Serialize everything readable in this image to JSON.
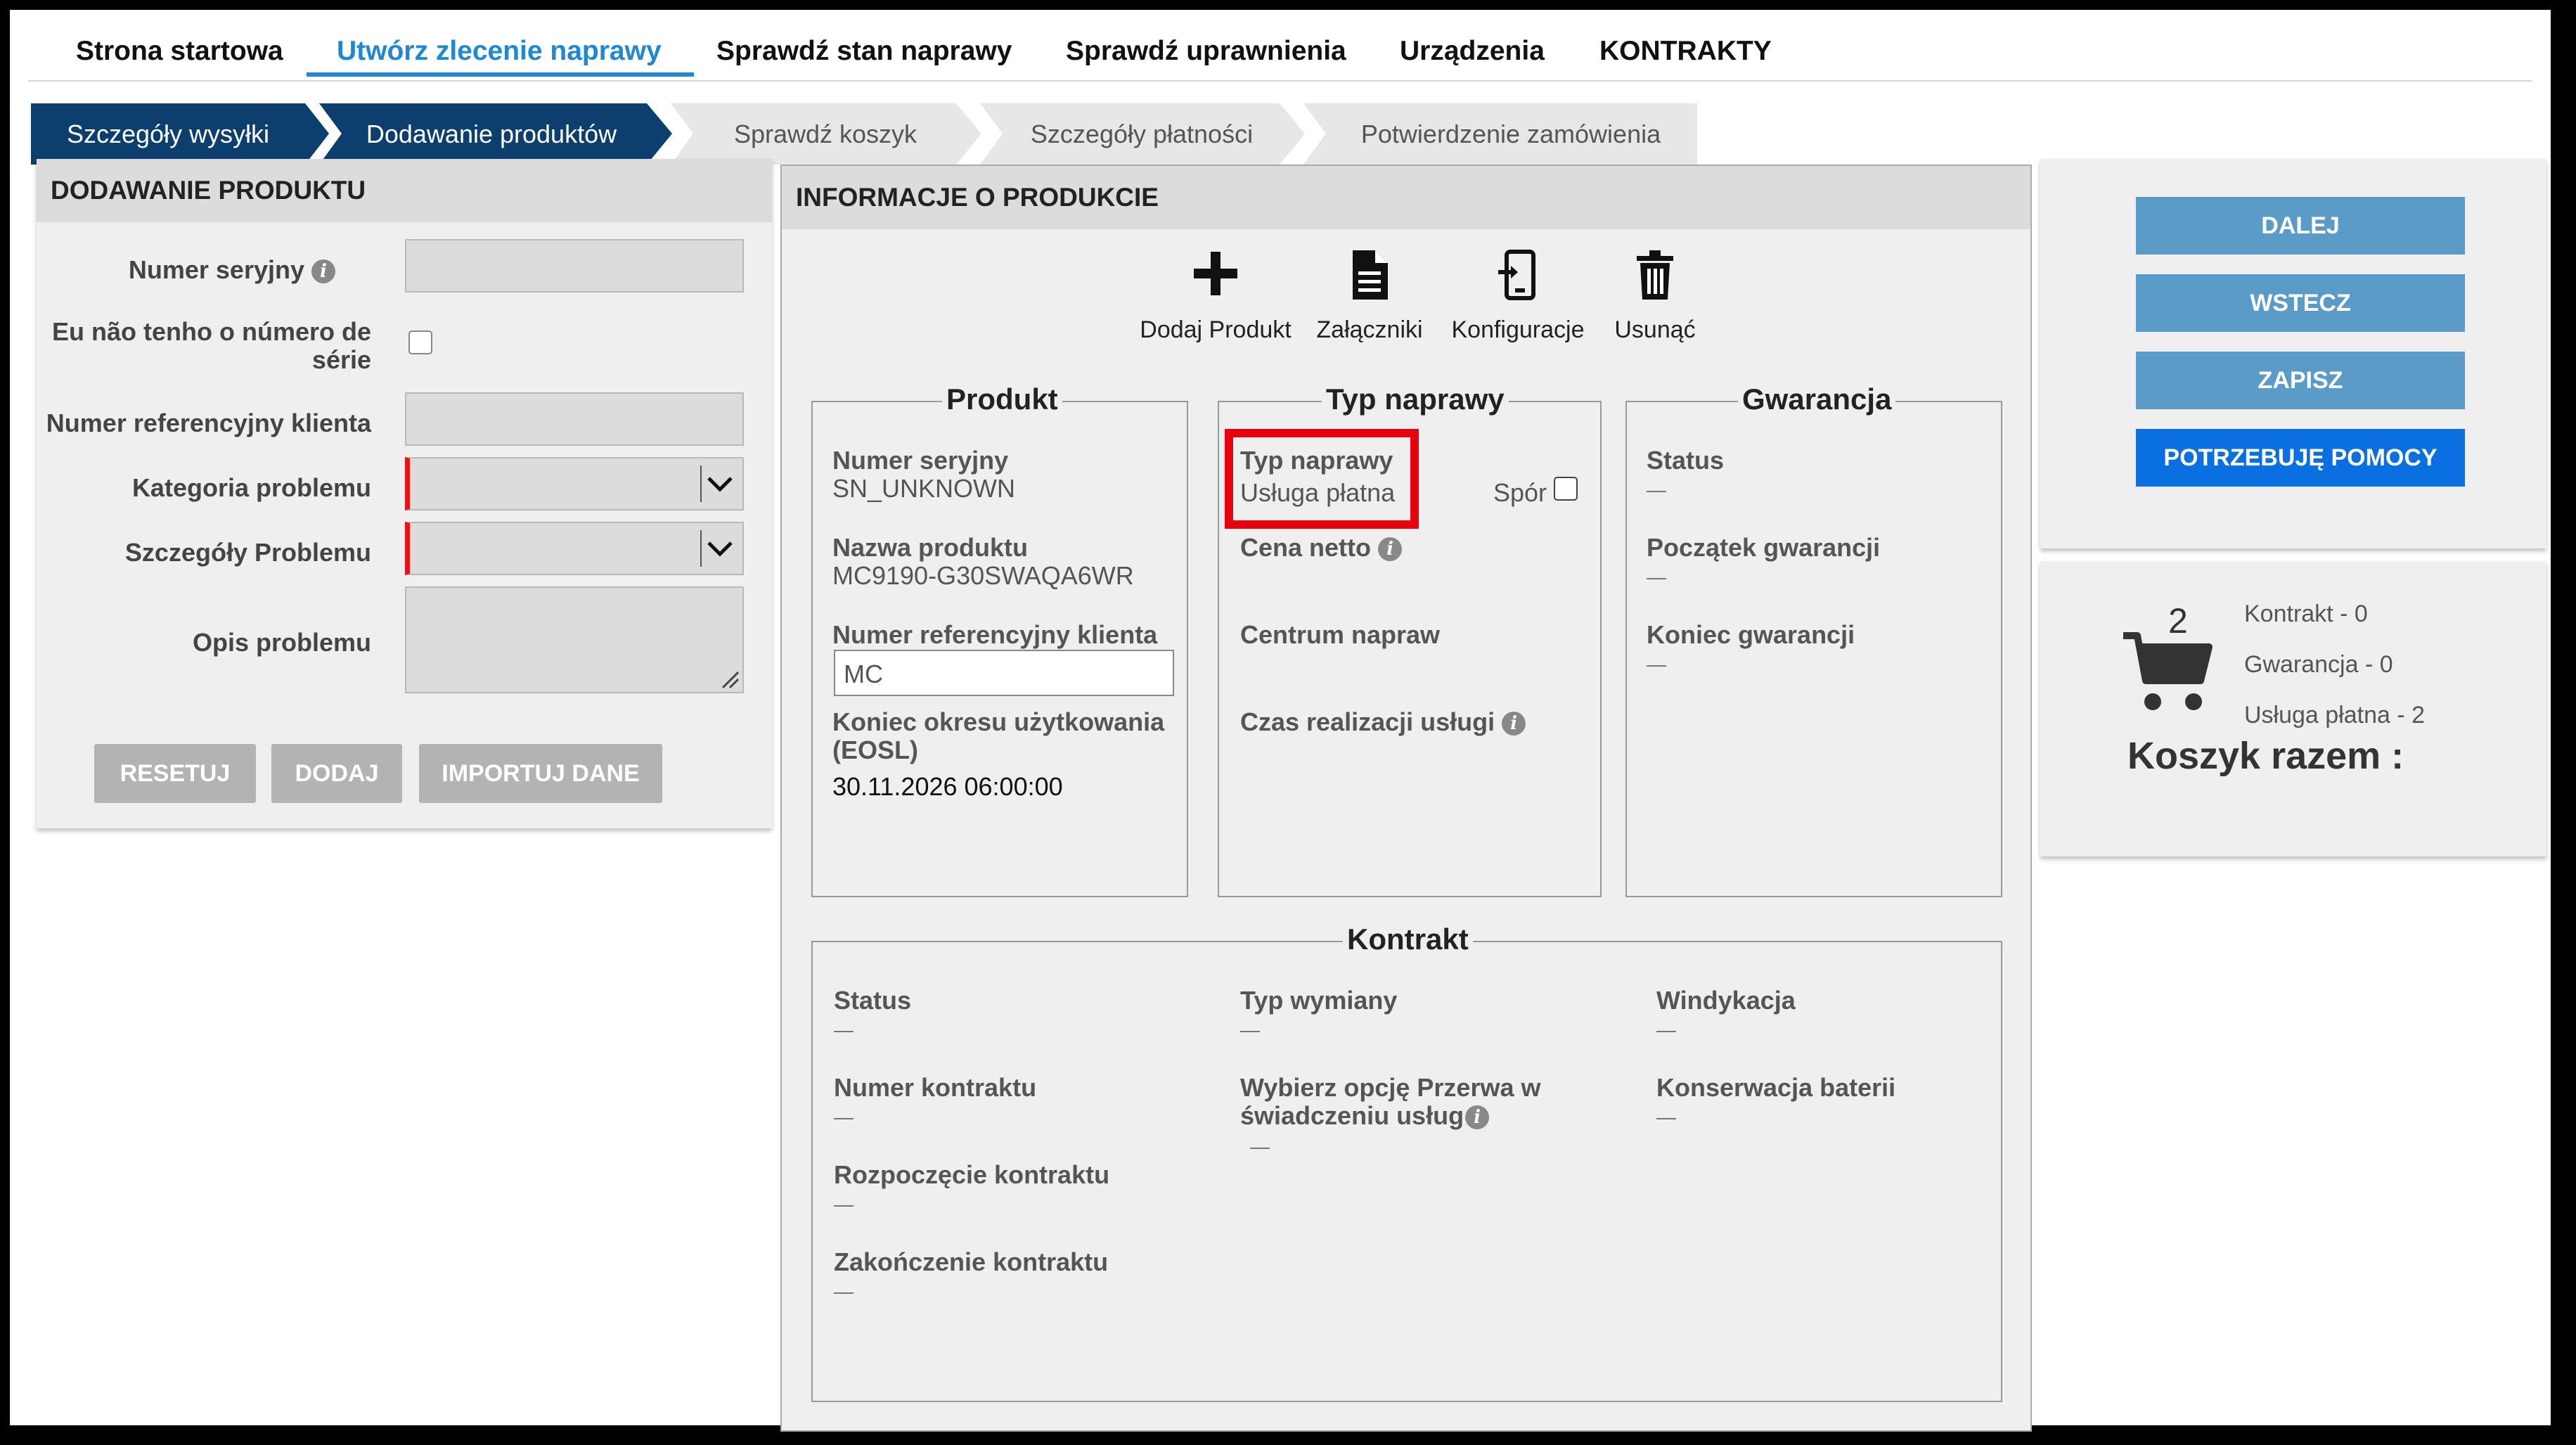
{
  "nav": {
    "items": [
      {
        "label": "Strona startowa"
      },
      {
        "label": "Utwórz zlecenie naprawy"
      },
      {
        "label": "Sprawdź stan naprawy"
      },
      {
        "label": "Sprawdź uprawnienia"
      },
      {
        "label": "Urządzenia"
      },
      {
        "label": "KONTRAKTY"
      }
    ],
    "active_color": "#1e88d4"
  },
  "steps": [
    {
      "label": "Szczegóły wysyłki",
      "state": "done"
    },
    {
      "label": "Dodawanie produktów",
      "state": "current"
    },
    {
      "label": "Sprawdź koszyk",
      "state": "todo"
    },
    {
      "label": "Szczegóły płatności",
      "state": "todo"
    },
    {
      "label": "Potwierdzenie zamówienia",
      "state": "todo"
    }
  ],
  "add_product": {
    "title": "DODAWANIE PRODUKTU",
    "serial_label": "Numer seryjny",
    "no_serial_label_1": "Eu não tenho o número de",
    "no_serial_label_2": "série",
    "customer_ref_label": "Numer referencyjny klienta",
    "problem_category_label": "Kategoria problemu",
    "problem_details_label": "Szczegóły Problemu",
    "problem_desc_label": "Opis problemu",
    "reset_label": "RESETUJ",
    "add_label": "DODAJ",
    "import_label": "IMPORTUJ DANE"
  },
  "product_info": {
    "title": "INFORMACJE O PRODUKCIE",
    "tools": {
      "add": "Dodaj Produkt",
      "attachments": "Załączniki",
      "config": "Konfiguracje",
      "remove": "Usunąć"
    },
    "product": {
      "legend": "Produkt",
      "serial_label": "Numer seryjny",
      "serial_value": "SN_UNKNOWN",
      "name_label": "Nazwa produktu",
      "name_value": "MC9190-G30SWAQA6WR",
      "ref_label": "Numer referencyjny klienta",
      "ref_value": "MC",
      "eosl_label_1": "Koniec okresu użytkowania",
      "eosl_label_2": "(EOSL)",
      "eosl_value": "30.11.2026 06:00:00"
    },
    "repair_type": {
      "legend": "Typ naprawy",
      "type_label": "Typ naprawy",
      "type_value": "Usługa płatna",
      "dispute_label": "Spór",
      "net_price_label": "Cena netto",
      "repair_center_label": "Centrum napraw",
      "service_time_label": "Czas realizacji usługi"
    },
    "warranty": {
      "legend": "Gwarancja",
      "status_label": "Status",
      "start_label": "Początek gwarancji",
      "end_label": "Koniec gwarancji"
    },
    "contract": {
      "legend": "Kontrakt",
      "status_label": "Status",
      "number_label": "Numer kontraktu",
      "start_label": "Rozpoczęcie kontraktu",
      "end_label": "Zakończenie kontraktu",
      "exchange_type_label": "Typ wymiany",
      "break_label_1": "Wybierz opcję Przerwa w",
      "break_label_2": "świadczeniu usług",
      "recovery_label": "Windykacja",
      "battery_label": "Konserwacja baterii"
    }
  },
  "actions": {
    "next": "DALEJ",
    "back": "WSTECZ",
    "save": "ZAPISZ",
    "help": "POTRZEBUJĘ POMOCY"
  },
  "cart": {
    "count": "2",
    "contract": "Kontrakt - 0",
    "warranty": "Gwarancja - 0",
    "paid": "Usługa płatna - 2",
    "total_label": "Koszyk razem :"
  },
  "colors": {
    "nav_dark": "#0c3f6e",
    "action_button": "#5b9bc8",
    "help_button": "#0a6fe0",
    "highlight": "#e8000e"
  }
}
